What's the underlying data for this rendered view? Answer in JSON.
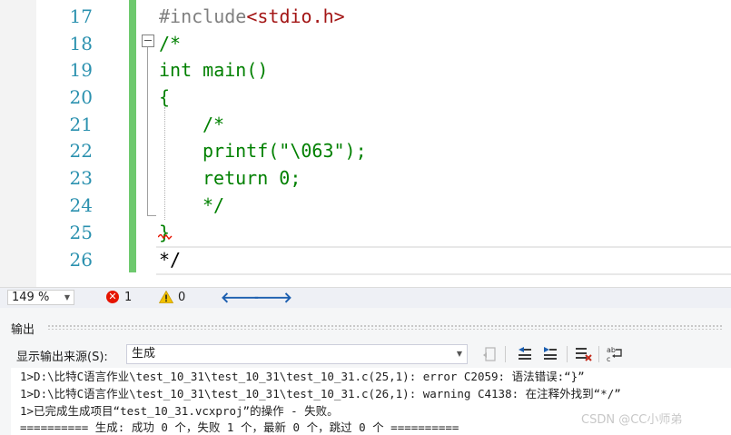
{
  "editor": {
    "lines": [
      {
        "num": "17",
        "indent": 0,
        "text": "#include<stdio.h>"
      },
      {
        "num": "18",
        "indent": 0,
        "text": "/*"
      },
      {
        "num": "19",
        "indent": 0,
        "text": "int main()"
      },
      {
        "num": "20",
        "indent": 0,
        "text": "{"
      },
      {
        "num": "21",
        "indent": 1,
        "text": "/*"
      },
      {
        "num": "22",
        "indent": 1,
        "text": "printf(\"\\063\");"
      },
      {
        "num": "23",
        "indent": 1,
        "text": "return 0;"
      },
      {
        "num": "24",
        "indent": 1,
        "text": "*/"
      },
      {
        "num": "25",
        "indent": 0,
        "text": "}"
      },
      {
        "num": "26",
        "indent": 0,
        "text": "*/"
      }
    ],
    "include_directive": "#include",
    "include_header": "<stdio.h>"
  },
  "status_bar": {
    "zoom": "149 %",
    "error_count": "1",
    "warning_count": "0"
  },
  "output": {
    "title": "输出",
    "source_label": "显示输出来源(S):",
    "source_value": "生成",
    "lines": [
      "1>D:\\比特C语言作业\\test_10_31\\test_10_31\\test_10_31.c(25,1): error C2059: 语法错误:“}”",
      "1>D:\\比特C语言作业\\test_10_31\\test_10_31\\test_10_31.c(26,1): warning C4138: 在注释外找到“*/”",
      "1>已完成生成项目“test_10_31.vcxproj”的操作 - 失败。",
      "========== 生成: 成功 0 个，失败 1 个，最新 0 个，跳过 0 个 =========="
    ]
  },
  "watermark": "CSDN @CC小师弟",
  "colors": {
    "comment": "#008000",
    "preprocessor": "#808080",
    "string": "#a31515",
    "line_number": "#2b91af",
    "change_bar": "#6ec96e",
    "error": "#e51400",
    "warning": "#f2c200"
  }
}
